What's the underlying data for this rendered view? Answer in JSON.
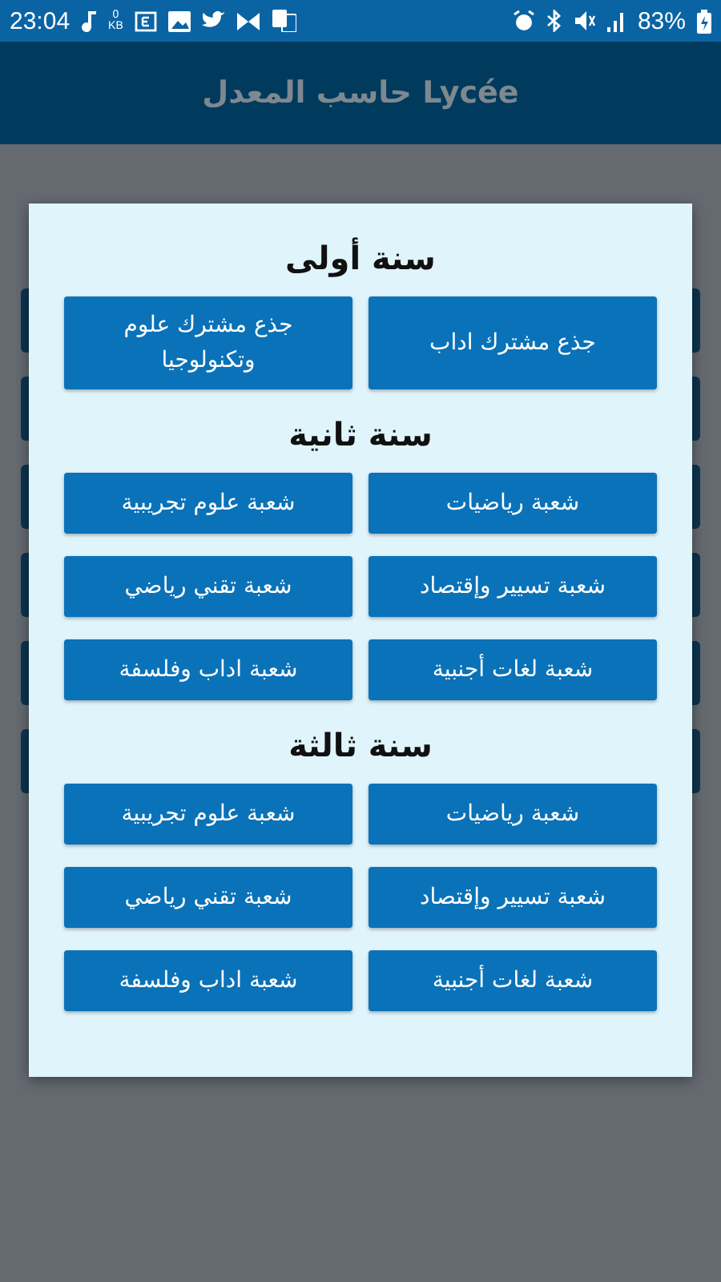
{
  "status_bar": {
    "time": "23:04",
    "data_rate": "0",
    "data_unit": "KB",
    "battery": "83%"
  },
  "app_bar": {
    "title": "حاسب المعدل Lycée"
  },
  "dialog": {
    "sections": [
      {
        "title": "سنة أولى",
        "buttons": [
          "جذع مشترك اداب",
          "جذع مشترك علوم وتكنولوجيا"
        ]
      },
      {
        "title": "سنة ثانية",
        "buttons": [
          "شعبة رياضيات",
          "شعبة علوم تجريبية",
          "شعبة تسيير وإقتصاد",
          "شعبة تقني رياضي",
          "شعبة لغات أجنبية",
          "شعبة اداب وفلسفة"
        ]
      },
      {
        "title": "سنة ثالثة",
        "buttons": [
          "شعبة رياضيات",
          "شعبة علوم تجريبية",
          "شعبة تسيير وإقتصاد",
          "شعبة تقني رياضي",
          "شعبة لغات أجنبية",
          "شعبة اداب وفلسفة"
        ]
      }
    ]
  }
}
